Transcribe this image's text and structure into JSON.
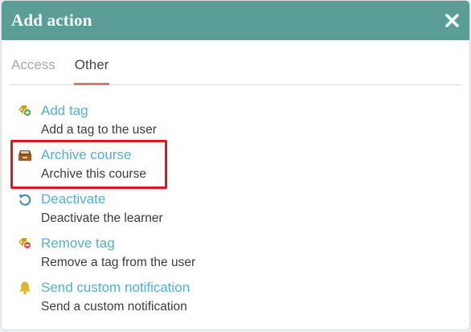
{
  "dialog": {
    "title": "Add action"
  },
  "tabs": [
    {
      "label": "Access",
      "active": false
    },
    {
      "label": "Other",
      "active": true
    }
  ],
  "actions": [
    {
      "label": "Add tag",
      "description": "Add a tag to the user",
      "icon": "tag-plus-icon"
    },
    {
      "label": "Archive course",
      "description": "Archive this course",
      "icon": "archive-box-icon"
    },
    {
      "label": "Deactivate",
      "description": "Deactivate the learner",
      "icon": "rotate-left-icon"
    },
    {
      "label": "Remove tag",
      "description": "Remove a tag from the user",
      "icon": "tag-minus-icon"
    },
    {
      "label": "Send custom notification",
      "description": "Send a custom notification",
      "icon": "bell-icon"
    }
  ],
  "colors": {
    "header": "#5b9e97",
    "link": "#52b0d4",
    "active_tab_underline": "#d9786c",
    "highlight": "#e8131b"
  }
}
